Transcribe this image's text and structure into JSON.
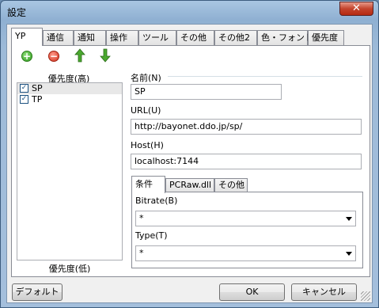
{
  "window": {
    "title": "設定",
    "close_label": "✕"
  },
  "tabs": [
    {
      "label": "YP",
      "active": true
    },
    {
      "label": "通信"
    },
    {
      "label": "通知"
    },
    {
      "label": "操作"
    },
    {
      "label": "ツール"
    },
    {
      "label": "その他"
    },
    {
      "label": "その他2"
    },
    {
      "label": "色・フォント"
    },
    {
      "label": "優先度"
    }
  ],
  "toolbar": {
    "add_icon": "add-icon",
    "remove_icon": "remove-icon",
    "up_icon": "up-arrow-icon",
    "down_icon": "down-arrow-icon"
  },
  "list": {
    "header": "優先度(高)",
    "footer": "優先度(低)",
    "items": [
      {
        "label": "SP",
        "checked": true
      },
      {
        "label": "TP",
        "checked": true
      }
    ]
  },
  "detail": {
    "name_label": "名前(N)",
    "name_value": "SP",
    "url_label": "URL(U)",
    "url_value": "http://bayonet.ddo.jp/sp/",
    "host_label": "Host(H)",
    "host_value": "localhost:7144"
  },
  "inner_tabs": [
    {
      "label": "条件",
      "active": true
    },
    {
      "label": "PCRaw.dll"
    },
    {
      "label": "その他"
    }
  ],
  "conditions": {
    "bitrate_label": "Bitrate(B)",
    "bitrate_value": "*",
    "type_label": "Type(T)",
    "type_value": "*"
  },
  "buttons": {
    "default_label": "デフォルト",
    "ok_label": "OK",
    "cancel_label": "キャンセル"
  }
}
